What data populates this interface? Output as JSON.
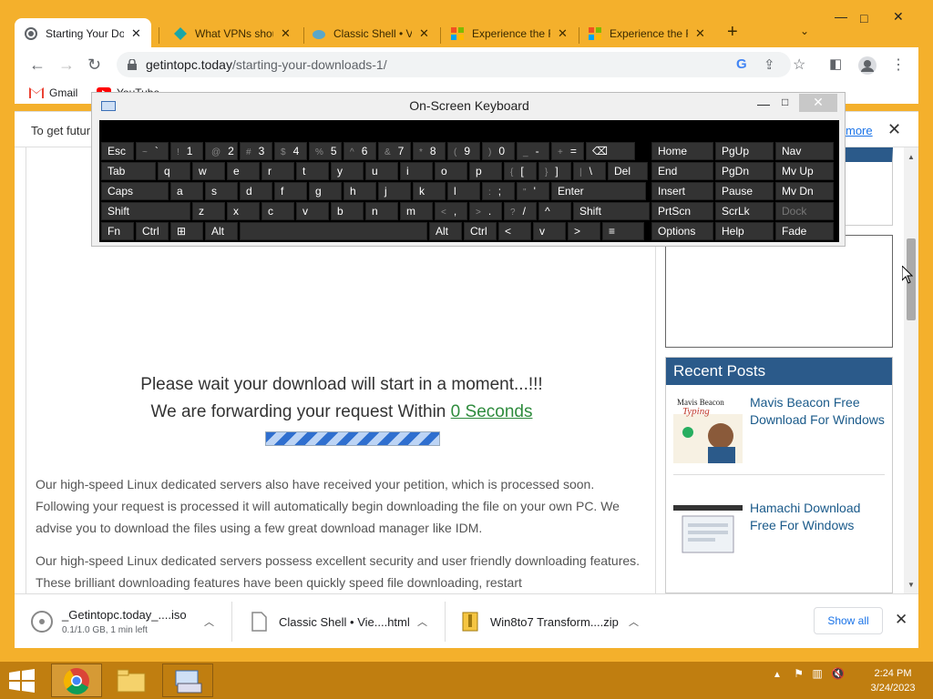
{
  "tabs": [
    {
      "title": "Starting Your Do",
      "active": true,
      "favicon": "globe-icon"
    },
    {
      "title": "What VPNs shou",
      "active": false,
      "favicon": "vpn-icon"
    },
    {
      "title": "Classic Shell • Vi",
      "active": false,
      "favicon": "shell-icon"
    },
    {
      "title": "Experience the F",
      "active": false,
      "favicon": "windows-flag-icon"
    },
    {
      "title": "Experience the F",
      "active": false,
      "favicon": "windows-flag-icon"
    }
  ],
  "new_tab_label": "+",
  "address": {
    "host": "getintopc.today",
    "path": "/starting-your-downloads-1/"
  },
  "bookmarks": {
    "gmail": "Gmail",
    "youtube": "YouTube"
  },
  "infobar": {
    "text": "To get futur",
    "more": "more"
  },
  "page": {
    "wait_line": "Please wait your download will start in a moment...!!!",
    "forward_prefix": "We are forwarding your request Within",
    "forward_seconds": "0 Seconds",
    "progress_percent": 100,
    "para1": "Our high-speed Linux dedicated servers also have received your petition, which is processed soon. Following your request is processed it will automatically begin downloading the file on your own PC. We advise you to download the files using a few great download manager like IDM.",
    "para2": "Our high-speed Linux dedicated servers possess excellent security and user friendly downloading features. These brilliant downloading features have been quickly speed file downloading, restart"
  },
  "sidebar": {
    "recent_title": "Recent Posts",
    "posts": [
      {
        "title": "Mavis Beacon Free Download For Windows"
      },
      {
        "title": "Hamachi Download Free For Windows"
      }
    ]
  },
  "downloads": [
    {
      "name": "_Getintopc.today_....iso",
      "status": "0.1/1.0 GB, 1 min left",
      "icon": "disc-icon"
    },
    {
      "name": "Classic Shell • Vie....html",
      "status": "",
      "icon": "file-icon"
    },
    {
      "name": "Win8to7 Transform....zip",
      "status": "",
      "icon": "zip-icon"
    }
  ],
  "show_all": "Show all",
  "osk": {
    "title": "On-Screen Keyboard",
    "rows": [
      [
        "Esc",
        "~ `",
        "! 1",
        "@ 2",
        "# 3",
        "$ 4",
        "% 5",
        "^ 6",
        "& 7",
        "* 8",
        "( 9",
        ") 0",
        "_ -",
        "+ =",
        "⌫",
        "Home",
        "PgUp",
        "Nav"
      ],
      [
        "Tab",
        "q",
        "w",
        "e",
        "r",
        "t",
        "y",
        "u",
        "i",
        "o",
        "p",
        "{ [",
        "} ]",
        "| \\",
        "Del",
        "End",
        "PgDn",
        "Mv Up"
      ],
      [
        "Caps",
        "a",
        "s",
        "d",
        "f",
        "g",
        "h",
        "j",
        "k",
        "l",
        ": ;",
        "\" '",
        "Enter",
        "Insert",
        "Pause",
        "Mv Dn"
      ],
      [
        "Shift",
        "z",
        "x",
        "c",
        "v",
        "b",
        "n",
        "m",
        "< ,",
        "> .",
        "? /",
        "^",
        "Shift",
        "PrtScn",
        "ScrLk",
        "Dock"
      ],
      [
        "Fn",
        "Ctrl",
        "⊞",
        "Alt",
        "",
        "Alt",
        "Ctrl",
        "<",
        "v",
        ">",
        "≡",
        "Options",
        "Help",
        "Fade"
      ]
    ]
  },
  "clock": {
    "time": "2:24 PM",
    "date": "3/24/2023"
  },
  "colors": {
    "frame": "#f4b02c",
    "taskbar": "#c07e10",
    "accent": "#2b5a8a",
    "link": "#1a73e8"
  }
}
